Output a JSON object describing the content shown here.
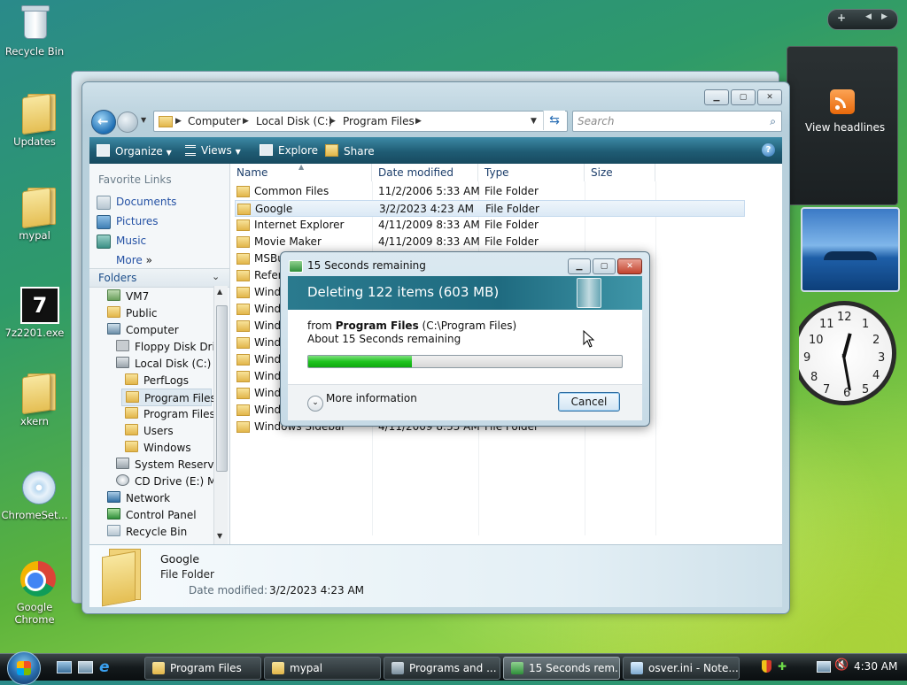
{
  "desktop": {
    "icons": [
      {
        "label": "Recycle Bin"
      },
      {
        "label": "Updates"
      },
      {
        "label": "mypal"
      },
      {
        "label": "7z2201.exe"
      },
      {
        "label": "xkern"
      },
      {
        "label": "ChromeSet..."
      },
      {
        "label": "Google Chrome"
      }
    ]
  },
  "gadgets": {
    "feed_label": "View headlines",
    "clock_numbers": [
      "12",
      "1",
      "2",
      "3",
      "4",
      "5",
      "6",
      "7",
      "8",
      "9",
      "10",
      "11"
    ]
  },
  "explorer": {
    "breadcrumb": [
      "Computer",
      "Local Disk (C:)",
      "Program Files"
    ],
    "search_placeholder": "Search",
    "toolbar": {
      "organize": "Organize",
      "views": "Views",
      "explore": "Explore",
      "share": "Share"
    },
    "favorite_links_header": "Favorite Links",
    "favorite_links": [
      "Documents",
      "Pictures",
      "Music"
    ],
    "more_label": "More",
    "folders_header": "Folders",
    "tree": [
      "VM7",
      "Public",
      "Computer",
      "Floppy Disk Drive",
      "Local Disk (C:)",
      "PerfLogs",
      "Program Files",
      "Program Files (",
      "Users",
      "Windows",
      "System Reserved",
      "CD Drive (E:) My",
      "Network",
      "Control Panel",
      "Recycle Bin"
    ],
    "columns": [
      "Name",
      "Date modified",
      "Type",
      "Size"
    ],
    "files": [
      {
        "name": "Common Files",
        "date": "11/2/2006 5:33 AM",
        "type": "File Folder"
      },
      {
        "name": "Google",
        "date": "3/2/2023 4:23 AM",
        "type": "File Folder"
      },
      {
        "name": "Internet Explorer",
        "date": "4/11/2009 8:33 AM",
        "type": "File Folder"
      },
      {
        "name": "Movie Maker",
        "date": "4/11/2009 8:33 AM",
        "type": "File Folder"
      },
      {
        "name": "MSBu",
        "date": "",
        "type": ""
      },
      {
        "name": "Refere",
        "date": "",
        "type": ""
      },
      {
        "name": "Windo",
        "date": "",
        "type": ""
      },
      {
        "name": "Windo",
        "date": "",
        "type": ""
      },
      {
        "name": "Windo",
        "date": "",
        "type": ""
      },
      {
        "name": "Windo",
        "date": "",
        "type": ""
      },
      {
        "name": "Windo",
        "date": "",
        "type": ""
      },
      {
        "name": "Windo",
        "date": "",
        "type": ""
      },
      {
        "name": "Windo",
        "date": "",
        "type": ""
      },
      {
        "name": "Windo",
        "date": "",
        "type": ""
      },
      {
        "name": "Windows Sidebar",
        "date": "4/11/2009 8:33 AM",
        "type": "File Folder"
      }
    ],
    "details": {
      "name": "Google",
      "type": "File Folder",
      "date_label": "Date modified:",
      "date_value": "3/2/2023 4:23 AM"
    }
  },
  "dialog": {
    "title": "15 Seconds remaining",
    "heading": "Deleting 122 items (603 MB)",
    "from_prefix": "from",
    "from_name": "Program Files",
    "from_path": "(C:\\Program Files)",
    "remaining": "About 15 Seconds remaining",
    "progress": 0.33,
    "more_info": "More information",
    "cancel": "Cancel"
  },
  "taskbar": {
    "buttons": [
      {
        "label": "Program Files"
      },
      {
        "label": "mypal"
      },
      {
        "label": "Programs and ..."
      },
      {
        "label": "15 Seconds rem..."
      },
      {
        "label": "osver.ini - Note..."
      }
    ],
    "time": "4:30 AM"
  }
}
